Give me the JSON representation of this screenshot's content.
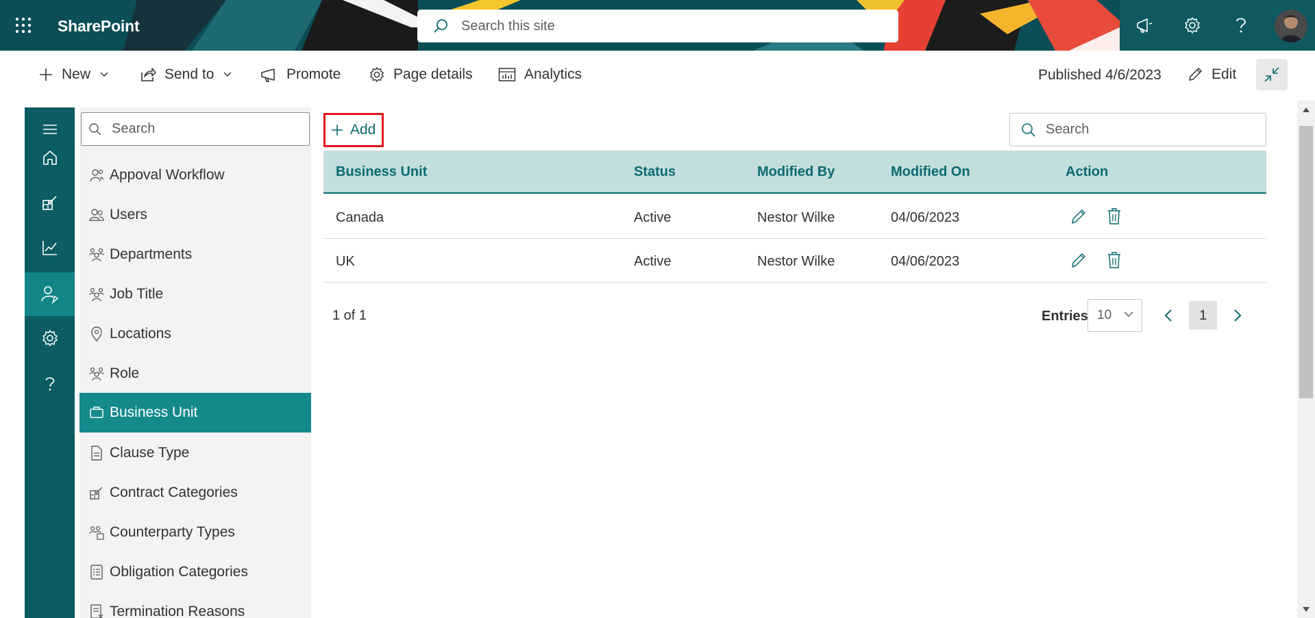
{
  "suite": {
    "brand": "SharePoint",
    "search_placeholder": "Search this site",
    "icons": [
      "waffle-icon",
      "megaphone-icon",
      "gear-icon",
      "help-icon",
      "avatar"
    ]
  },
  "commandbar": {
    "new_label": "New",
    "send_to_label": "Send to",
    "promote_label": "Promote",
    "page_details_label": "Page details",
    "analytics_label": "Analytics",
    "published_text": "Published 4/6/2023",
    "edit_label": "Edit"
  },
  "rail": {
    "items": [
      "menu-icon",
      "home-icon",
      "contracts-icon",
      "analytics-icon",
      "user-settings-icon",
      "gear-icon",
      "help-icon"
    ],
    "active_index": 4
  },
  "nav": {
    "search_placeholder": "Search",
    "items": [
      {
        "label": "Appoval Workflow",
        "icon": "workflow-icon"
      },
      {
        "label": "Users",
        "icon": "users-icon"
      },
      {
        "label": "Departments",
        "icon": "departments-icon"
      },
      {
        "label": "Job Title",
        "icon": "job-title-icon"
      },
      {
        "label": "Locations",
        "icon": "location-pin-icon"
      },
      {
        "label": "Role",
        "icon": "role-icon"
      },
      {
        "label": "Business Unit",
        "icon": "briefcase-icon",
        "active": true
      },
      {
        "label": "Clause Type",
        "icon": "document-icon"
      },
      {
        "label": "Contract Categories",
        "icon": "contract-categories-icon"
      },
      {
        "label": "Counterparty Types",
        "icon": "counterparty-icon"
      },
      {
        "label": "Obligation Categories",
        "icon": "list-document-icon"
      },
      {
        "label": "Termination Reasons",
        "icon": "termination-icon"
      }
    ]
  },
  "main": {
    "add_label": "Add",
    "search_placeholder": "Search",
    "table": {
      "columns": [
        "Business Unit",
        "Status",
        "Modified By",
        "Modified On",
        "Action"
      ],
      "rows": [
        {
          "business_unit": "Canada",
          "status": "Active",
          "modified_by": "Nestor Wilke",
          "modified_on": "04/06/2023"
        },
        {
          "business_unit": "UK",
          "status": "Active",
          "modified_by": "Nestor Wilke",
          "modified_on": "04/06/2023"
        }
      ]
    },
    "pager": {
      "summary": "1 of 1",
      "entries_label": "Entries",
      "entries_value": "10",
      "current_page": "1"
    }
  },
  "colors": {
    "accent": "#0b6a6e",
    "rail": "#0b5d63",
    "active_nav": "#158a8c",
    "header_row": "#c2dedd",
    "highlight_border": "#e0141c"
  }
}
